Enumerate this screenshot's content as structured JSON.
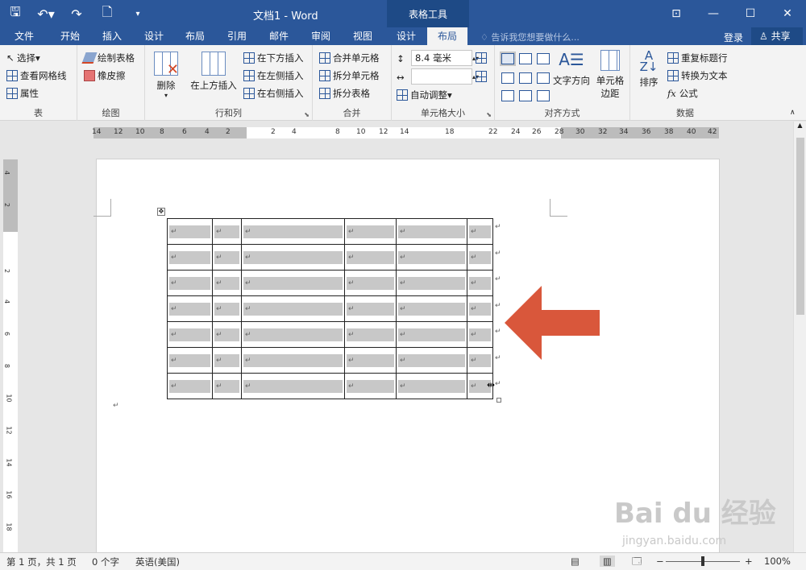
{
  "titlebar": {
    "document_title": "文档1 - Word",
    "context_group": "表格工具"
  },
  "tabs": [
    "文件",
    "开始",
    "插入",
    "设计",
    "布局",
    "引用",
    "邮件",
    "审阅",
    "视图",
    "设计",
    "布局"
  ],
  "active_tab_index": 10,
  "tell_me": "告诉我您想要做什么...",
  "account": {
    "login": "登录",
    "share": "共享"
  },
  "ribbon": {
    "table": {
      "select": "选择",
      "view_gridlines": "查看网格线",
      "properties": "属性",
      "label": "表"
    },
    "draw": {
      "draw_table": "绘制表格",
      "eraser": "橡皮擦",
      "label": "绘图"
    },
    "rows_cols": {
      "delete": "删除",
      "insert_above": "在上方插入",
      "insert_below": "在下方插入",
      "insert_left": "在左侧插入",
      "insert_right": "在右侧插入",
      "label": "行和列"
    },
    "merge": {
      "merge_cells": "合并单元格",
      "split_cells": "拆分单元格",
      "split_table": "拆分表格",
      "label": "合并"
    },
    "cell_size": {
      "height_value": "8.4 毫米",
      "width_value": "",
      "autofit": "自动调整",
      "label": "单元格大小"
    },
    "alignment": {
      "text_direction": "文字方向",
      "cell_margins_1": "单元格",
      "cell_margins_2": "边距",
      "label": "对齐方式"
    },
    "data": {
      "sort": "排序",
      "repeat_header": "重复标题行",
      "convert_to_text": "转换为文本",
      "formula": "公式",
      "label": "数据"
    }
  },
  "ruler": {
    "h_ticks": [
      "14",
      "12",
      "10",
      "8",
      "6",
      "4",
      "2",
      "2",
      "4",
      "8",
      "10",
      "12",
      "14",
      "18",
      "22",
      "24",
      "26",
      "28",
      "30",
      "32",
      "34",
      "36",
      "38",
      "40",
      "42"
    ],
    "v_ticks": [
      "4",
      "2",
      "2",
      "4",
      "6",
      "8",
      "10",
      "12",
      "14",
      "16",
      "18"
    ]
  },
  "table": {
    "rows": 7,
    "cols": 6,
    "mark": "↵"
  },
  "statusbar": {
    "page": "第 1 页，共 1 页",
    "words": "0 个字",
    "language": "英语(美国)",
    "zoom": "100%"
  },
  "watermark": {
    "logo": "Bai du 经验",
    "url": "jingyan.baidu.com"
  },
  "colors": {
    "brand": "#2b579a",
    "arrow": "#d9573b"
  }
}
